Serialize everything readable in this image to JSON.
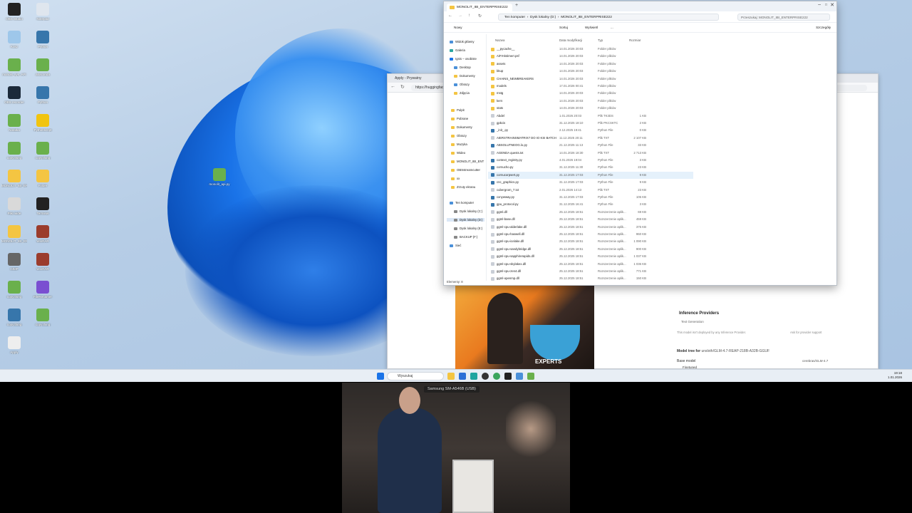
{
  "taskbar": {
    "search_placeholder": "Wyszukaj",
    "clock_time": "19:18",
    "clock_date": "1.01.2026"
  },
  "browser": {
    "tab_title": "Apply - Prywatny",
    "url": "https://huggingface.co",
    "inference_providers": "Inference Providers",
    "text_generation": "Text Generation",
    "not_deployed": "This model isn't deployed by any Inference Provider.",
    "ask_support": "Ask for provider support",
    "model_tree": "Model tree for",
    "model_tree_repo": "unsloth/GLM-4.7-REAP-218B-A32B-GGUF",
    "base_model": "Base model",
    "base_model_value": "cerebras/GLM-4.7",
    "finetuned": "Finetuned",
    "experts_text": "EXPERTS"
  },
  "explorer": {
    "tab_title": "MONOLIT_IBI_ENTERPRISE222",
    "breadcrumb": [
      "Ten komputer",
      "Dysk lokalny (D:)",
      "MONOLIT_IBI_ENTERPRISE222"
    ],
    "search_placeholder": "Przeszukaj: MONOLIT_IBI_ENTERPRISE222",
    "cmd_new": "Nowy",
    "cmd_sort": "Sortuj",
    "cmd_view": "Wyświetl",
    "cmd_more": "...",
    "cmd_details": "Szczegóły",
    "columns": [
      "Nazwa",
      "Data modyfikacji",
      "Typ",
      "Rozmiar"
    ],
    "nav": {
      "home": "Widok główny",
      "gallery": "Galeria",
      "cloud": "Ignis – osobiste",
      "desktop": "Desktop",
      "documents": "Dokumenty",
      "pictures": "Obrazy",
      "prev_shots": "Zdjęcia",
      "pinned": [
        "Pulpit",
        "Pobrane",
        "Dokumenty",
        "Obrazy",
        "Muzyka",
        "Wideo",
        "MONOLIT_IBI_ENT",
        "OBSstreamcutter",
        "xx",
        "Zrzuty ekranu"
      ],
      "this_pc": "Ten komputer",
      "drives": [
        "Dysk lokalny (C:)",
        "Dysk lokalny (D:)",
        "Dysk lokalny (E:)",
        "BACKUP (F:)"
      ],
      "network": "Sieć"
    },
    "files": [
      {
        "name": "__pycache__",
        "date": "14.01.2026 20:03",
        "type": "Folder plików",
        "size": ""
      },
      {
        "name": "AiFrHistimerr.psf",
        "date": "14.01.2026 20:03",
        "type": "Folder plików",
        "size": ""
      },
      {
        "name": "assets",
        "date": "14.01.2026 20:03",
        "type": "Folder plików",
        "size": ""
      },
      {
        "name": "bkup",
        "date": "14.01.2026 20:03",
        "type": "Folder plików",
        "size": ""
      },
      {
        "name": "CHAINS_NEWBREAKERS",
        "date": "14.01.2026 20:03",
        "type": "Folder plików",
        "size": ""
      },
      {
        "name": "models",
        "date": "17.01.2026 00:41",
        "type": "Folder plików",
        "size": ""
      },
      {
        "name": "mstg",
        "date": "14.01.2026 20:03",
        "type": "Folder plików",
        "size": ""
      },
      {
        "name": "kern",
        "date": "14.01.2026 20:03",
        "type": "Folder plików",
        "size": ""
      },
      {
        "name": "stats",
        "date": "14.01.2026 20:03",
        "type": "Folder plików",
        "size": ""
      },
      {
        "name": "Abdel",
        "date": "1.01.2026 20:03",
        "type": "Plik TK3DS",
        "size": "1 KB"
      },
      {
        "name": "gpkcis",
        "date": "31.12.2025 18:10",
        "type": "Plik PKCSKTC",
        "size": "2 KB"
      },
      {
        "name": "_init_.py",
        "date": "2.12.2025 19:41",
        "type": "Python File",
        "size": "0 KB"
      },
      {
        "name": "AIERSTRAINSMATRIX7 DO IO KSI BATCH",
        "date": "11.12.2025 20:11",
        "type": "Plik TXT",
        "size": "2 107 KB"
      },
      {
        "name": "ABSOLUTNEOG.lo.py",
        "date": "21.12.2025 11:13",
        "type": "Python File",
        "size": "33 KB"
      },
      {
        "name": "AGENDA quests.txt",
        "date": "14.01.2026 18:30",
        "type": "Plik TXT",
        "size": "2 713 KB"
      },
      {
        "name": "context_registry.py",
        "date": "4.01.2026 19:04",
        "type": "Python File",
        "size": "3 KB"
      },
      {
        "name": "cornucho.py",
        "date": "31.12.2025 11:30",
        "type": "Python File",
        "size": "23 KB"
      },
      {
        "name": "cornucorpsert.py",
        "date": "31.12.2025 17:03",
        "type": "Python File",
        "size": "9 KB"
      },
      {
        "name": "cnc_graphics.py",
        "date": "31.12.2025 17:03",
        "type": "Python File",
        "size": "9 KB"
      },
      {
        "name": "cubergrom_7.txt",
        "date": "2.01.2026 14:13",
        "type": "Plik TXT",
        "size": "23 KB"
      },
      {
        "name": "cxnywway.py",
        "date": "31.12.2025 17:03",
        "type": "Python File",
        "size": "105 KB"
      },
      {
        "name": "gpu_protocol.py",
        "date": "31.12.2025 16:41",
        "type": "Python File",
        "size": "3 KB"
      },
      {
        "name": "ggml.dll",
        "date": "25.12.2025 18:51",
        "type": "Rozszerzenie aplik...",
        "size": "69 KB"
      },
      {
        "name": "ggml-base.dll",
        "date": "25.12.2025 18:51",
        "type": "Rozszerzenie aplik...",
        "size": "459 KB"
      },
      {
        "name": "ggml-cpu-alderlake.dll",
        "date": "25.12.2025 18:51",
        "type": "Rozszerzenie aplik...",
        "size": "375 KB"
      },
      {
        "name": "ggml-cpu-haswell.dll",
        "date": "25.12.2025 18:51",
        "type": "Rozszerzenie aplik...",
        "size": "960 KB"
      },
      {
        "name": "ggml-cpu-icelake.dll",
        "date": "25.12.2025 18:51",
        "type": "Rozszerzenie aplik...",
        "size": "1 090 KB"
      },
      {
        "name": "ggml-cpu-sandybridge.dll",
        "date": "25.12.2025 18:51",
        "type": "Rozszerzenie aplik...",
        "size": "900 KB"
      },
      {
        "name": "ggml-cpu-sapphirerapids.dll",
        "date": "25.12.2025 18:51",
        "type": "Rozszerzenie aplik...",
        "size": "1 037 KB"
      },
      {
        "name": "ggml-cpu-skylakex.dll",
        "date": "25.12.2025 18:51",
        "type": "Rozszerzenie aplik...",
        "size": "1 036 KB"
      },
      {
        "name": "ggml-cpu-zen4.dll",
        "date": "25.12.2025 18:51",
        "type": "Rozszerzenie aplik...",
        "size": "771 KB"
      },
      {
        "name": "ggml-openmp.dll",
        "date": "25.12.2025 18:51",
        "type": "Rozszerzenie aplik...",
        "size": "150 KB"
      }
    ],
    "status": "Elementy: 8"
  },
  "desktop": {
    "icons": [
      "OBS Studio",
      "Notepad",
      "Kosz",
      "Python",
      "monolit_sys_API",
      "anaconda",
      "OBS recorder",
      "Python",
      "Notatka",
      "Pythonscript",
      "copy.thing",
      "copy.thing",
      "MONOLIT_IBI_EN",
      "Folder",
      "Pliki wide",
      "Terminal",
      "MONOLIT_IBI_EN",
      "WinRAR",
      "GIMP",
      "WinRAR",
      "copy.thing",
      "FileRenamer",
      "copy.thing",
      "copy.thing",
      "Apply"
    ],
    "floating_icon": "monolit_api.py"
  },
  "webcam": {
    "label": "Samsung SM-A546B (USB)"
  }
}
